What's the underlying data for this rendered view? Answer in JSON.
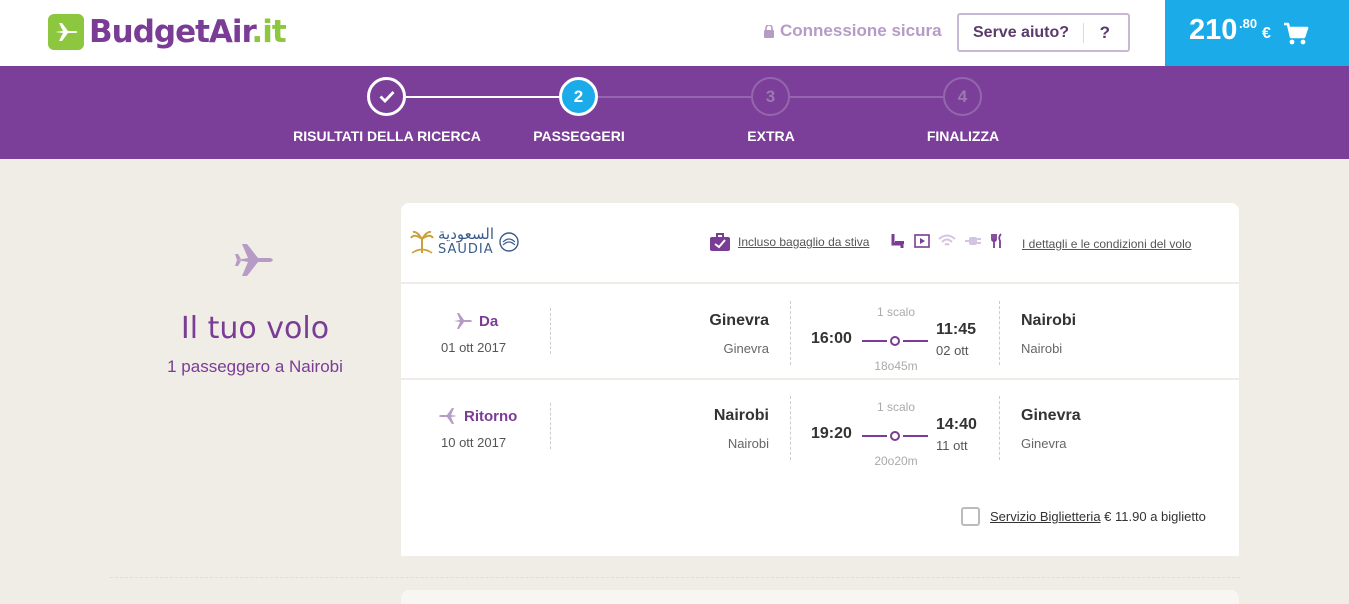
{
  "header": {
    "logo_text_main": "BudgetAir",
    "logo_text_tld": ".it",
    "secure_label": "Connessione sicura",
    "help_label": "Serve aiuto?",
    "help_icon": "?",
    "cart_amount": "210",
    "cart_decimals": ".80",
    "cart_currency": "€"
  },
  "steps": [
    {
      "label": "RISULTATI DELLA RICERCA",
      "num": "",
      "state": "done"
    },
    {
      "label": "PASSEGGERI",
      "num": "2",
      "state": "active"
    },
    {
      "label": "EXTRA",
      "num": "3",
      "state": "todo"
    },
    {
      "label": "FINALIZZA",
      "num": "4",
      "state": "todo"
    }
  ],
  "summary": {
    "title": "Il tuo volo",
    "subtitle": "1 passeggero a Nairobi"
  },
  "flight": {
    "airline_arabic": "السعودية",
    "airline_name": "SAUDIA",
    "baggage_label": "Incluso bagaglio da stiva",
    "details_label": "I dettagli e le condizioni del volo",
    "legs": [
      {
        "direction": "Da",
        "date": "01 ott 2017",
        "from_city": "Ginevra",
        "from_airport": "Ginevra",
        "stops": "1 scalo",
        "dep_time": "16:00",
        "arr_time": "11:45",
        "arr_date": "02 ott",
        "duration": "18o45m",
        "to_city": "Nairobi",
        "to_airport": "Nairobi"
      },
      {
        "direction": "Ritorno",
        "date": "10 ott 2017",
        "from_city": "Nairobi",
        "from_airport": "Nairobi",
        "stops": "1 scalo",
        "dep_time": "19:20",
        "arr_time": "14:40",
        "arr_date": "11 ott",
        "duration": "20o20m",
        "to_city": "Ginevra",
        "to_airport": "Ginevra"
      }
    ],
    "service_label": "Servizio Biglietteria",
    "service_price": "€ 11.90 a biglietto"
  },
  "colors": {
    "brand_purple": "#7b3f99",
    "accent_blue": "#1aabe8",
    "logo_green": "#8dc63f"
  }
}
